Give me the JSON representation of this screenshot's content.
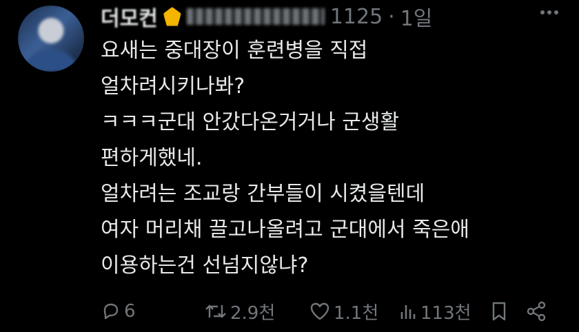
{
  "header": {
    "name_visible": "더모컨",
    "handle_tail": "1125",
    "separator": "·",
    "time": "1일",
    "more_icon": "more-horizontal-icon"
  },
  "reply": {
    "lines": [
      "요새는 중대장이 훈련병을 직접",
      "얼차려시키나봐?",
      "ㅋㅋㅋ군대 안갔다온거거나 군생활",
      "편하게했네.",
      "얼차려는 조교랑 간부들이 시켰을텐데",
      "여자 머리채 끌고나올려고 군대에서 죽은애",
      "이용하는건 선넘지않냐?"
    ]
  },
  "actions": {
    "replies": "6",
    "reposts": "2.9천",
    "likes": "1.1천",
    "views": "113천"
  },
  "colors": {
    "background": "#000000",
    "text": "#e7e9ea",
    "muted": "#71767b",
    "badge": "#f4b400"
  }
}
